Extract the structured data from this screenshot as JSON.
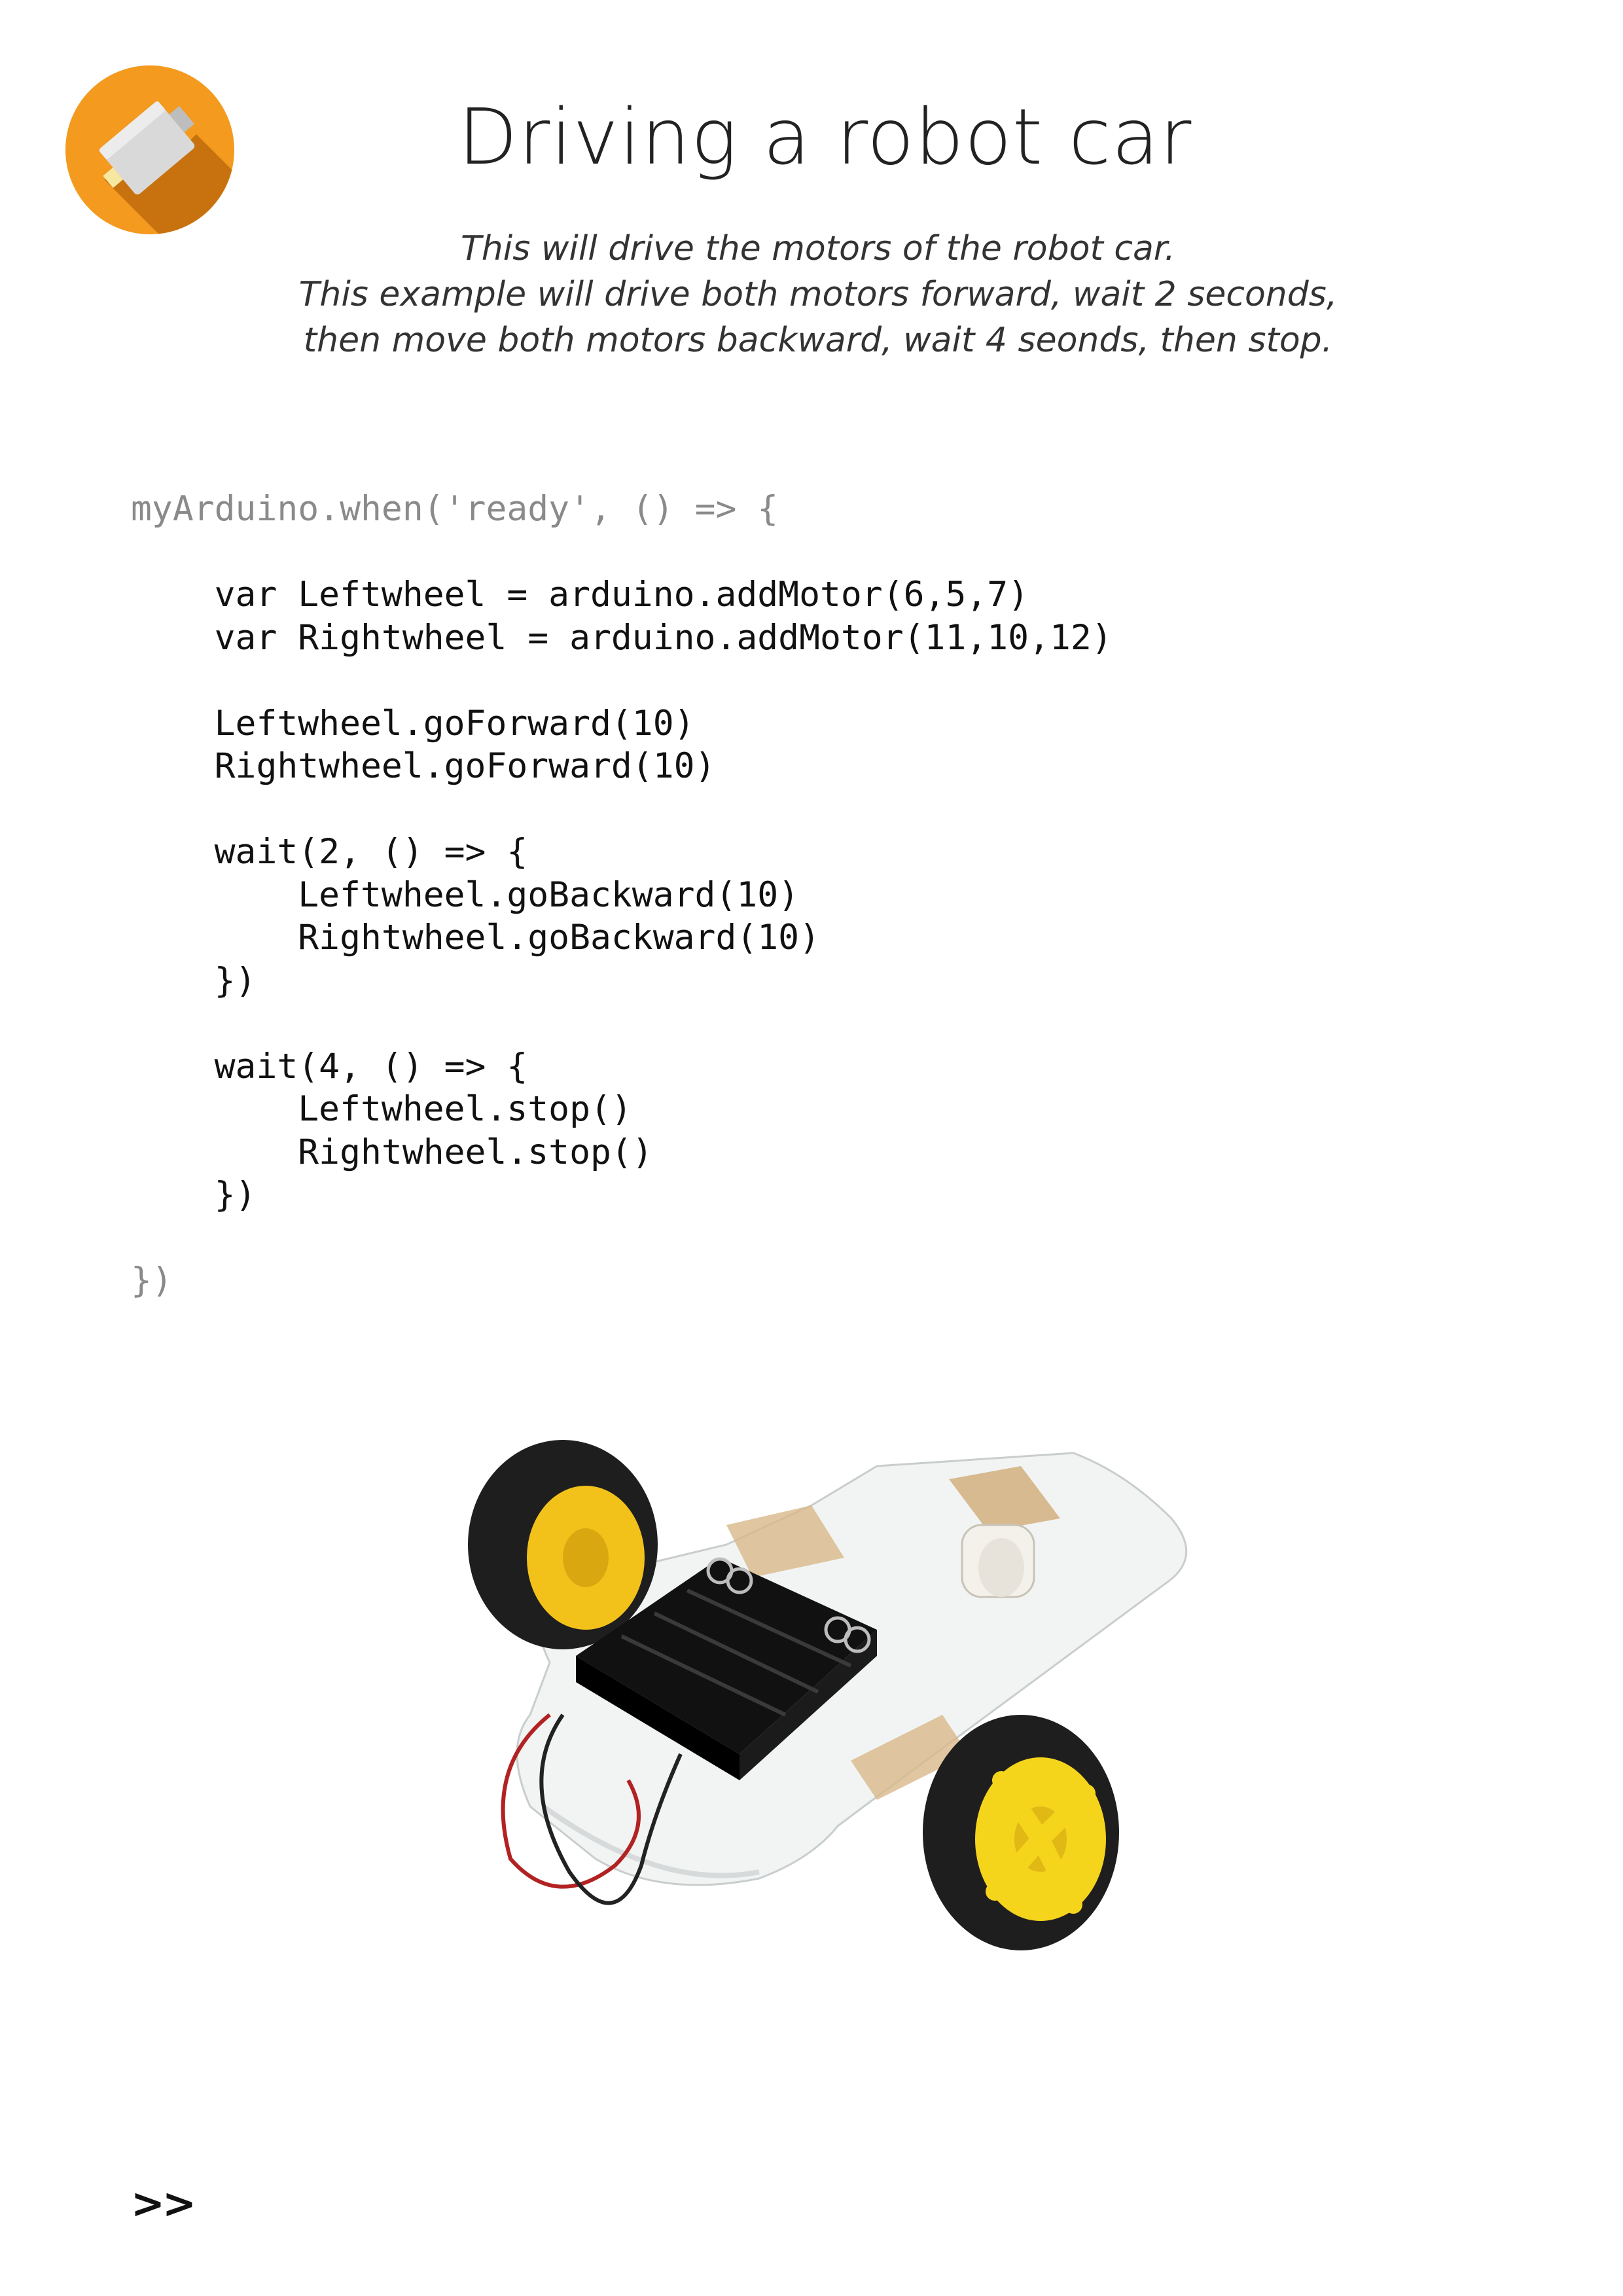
{
  "header": {
    "title": "Driving a robot car",
    "subtitle_lines": [
      "This will drive the motors of the robot car.",
      "This example will drive both motors forward, wait 2 seconds,",
      "then move both motors backward, wait 4 seonds, then stop."
    ],
    "logo_icon": "motor-icon",
    "colors": {
      "logo_orange": "#F39A1F",
      "logo_shadow": "#C8720F",
      "code_muted": "#8a8a8a"
    }
  },
  "code": {
    "lines": [
      "myArduino.when('ready', () => {",
      "",
      "    var Leftwheel = arduino.addMotor(6,5,7)",
      "    var Rightwheel = arduino.addMotor(11,10,12)",
      "",
      "    Leftwheel.goForward(10)",
      "    Rightwheel.goForward(10)",
      "",
      "    wait(2, () => {",
      "        Leftwheel.goBackward(10)",
      "        Rightwheel.goBackward(10)",
      "    })",
      "",
      "    wait(4, () => {",
      "        Leftwheel.stop()",
      "        Rightwheel.stop()",
      "    })",
      "",
      "})"
    ]
  },
  "footer": {
    "next_label": ">>"
  }
}
